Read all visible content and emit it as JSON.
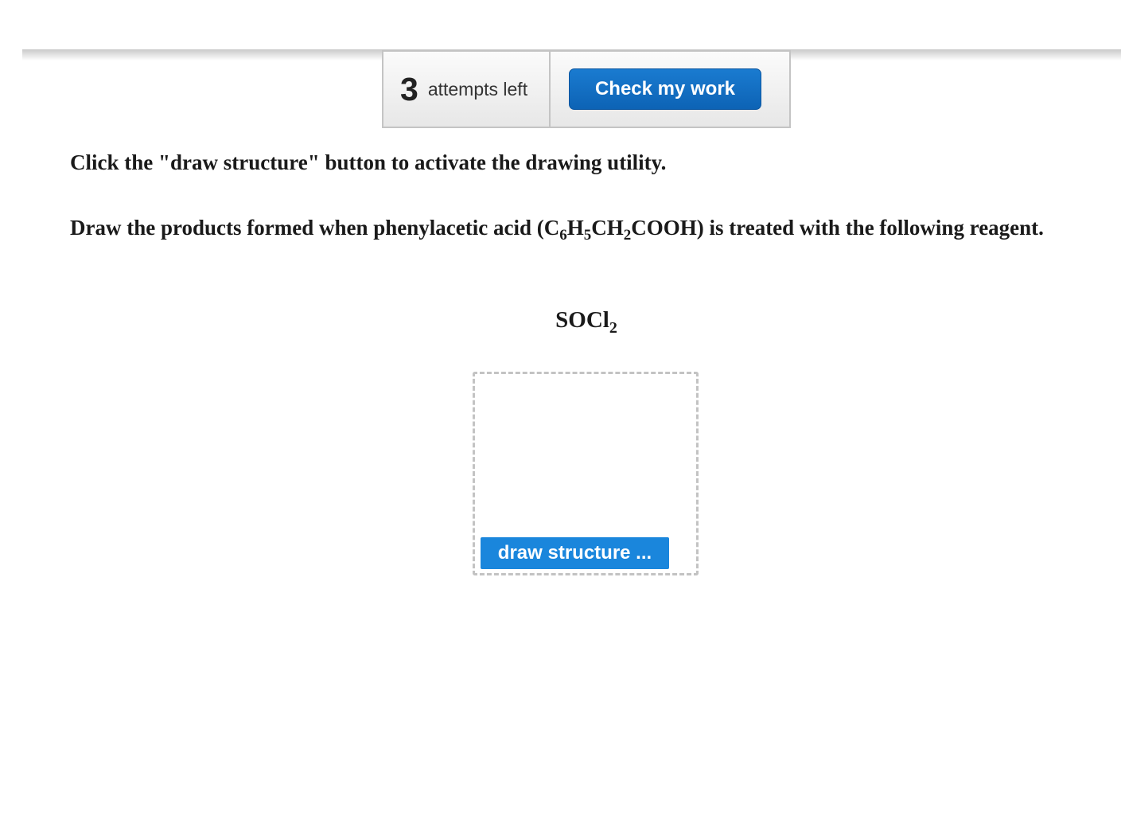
{
  "toolbar": {
    "attempts_count": "3",
    "attempts_label": "attempts left",
    "check_label": "Check my work"
  },
  "content": {
    "instruction": "Click the \"draw structure\" button to activate the drawing utility.",
    "question": {
      "part1": "Draw the products formed when phenylacetic acid (C",
      "sub1": "6",
      "part2": "H",
      "sub2": "5",
      "part3": "CH",
      "sub3": "2",
      "part4": "COOH) is treated with the following reagent."
    },
    "reagent": {
      "main": "SOCl",
      "sub": "2"
    }
  },
  "drawing": {
    "button_label": "draw structure ..."
  },
  "colors": {
    "primary_button": "#0d63b5",
    "draw_button": "#1a86dc",
    "dashed_border": "#c3c3c3"
  }
}
